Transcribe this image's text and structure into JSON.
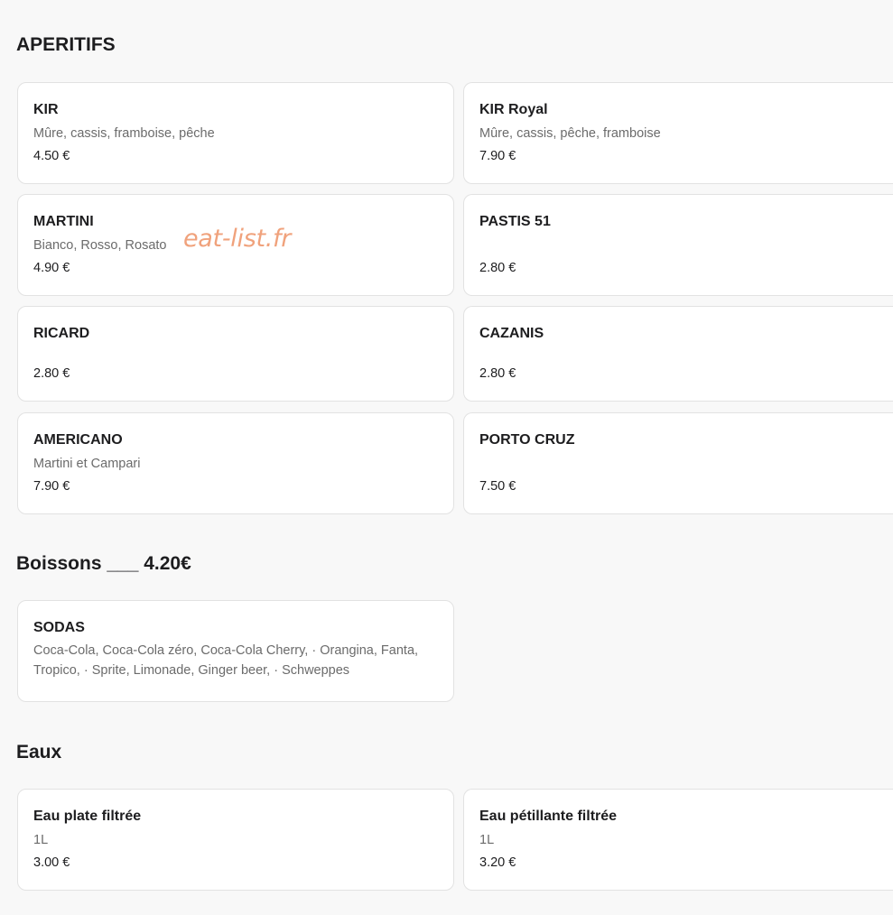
{
  "sections": {
    "aperitifs": {
      "title": "APERITIFS",
      "items": [
        {
          "name": "KIR",
          "description": "Mûre, cassis, framboise, pêche",
          "price": "4.50 €"
        },
        {
          "name": "KIR Royal",
          "description": "Mûre, cassis, pêche, framboise",
          "price": "7.90 €"
        },
        {
          "name": "MARTINI",
          "description": "Bianco, Rosso, Rosato",
          "price": "4.90 €"
        },
        {
          "name": "PASTIS 51",
          "description": "",
          "price": "2.80 €"
        },
        {
          "name": "RICARD",
          "description": "",
          "price": "2.80 €"
        },
        {
          "name": "CAZANIS",
          "description": "",
          "price": "2.80 €"
        },
        {
          "name": "AMERICANO",
          "description": "Martini et Campari",
          "price": "7.90 €"
        },
        {
          "name": "PORTO CRUZ",
          "description": "",
          "price": "7.50 €"
        }
      ]
    },
    "boissons": {
      "title": "Boissons ___ 4.20€",
      "items": [
        {
          "name": "SODAS",
          "description": "Coca-Cola, Coca-Cola zéro, Coca-Cola Cherry, · Orangina, Fanta, Tropico, · Sprite, Limonade, Ginger beer, · Schweppes"
        }
      ]
    },
    "eaux": {
      "title": "Eaux",
      "items": [
        {
          "name": "Eau plate filtrée",
          "description": "1L",
          "price": "3.00 €"
        },
        {
          "name": "Eau pétillante filtrée",
          "description": "1L",
          "price": "3.20 €"
        }
      ]
    }
  },
  "watermark": "eat-list.fr",
  "colors": {
    "background": "#f8f8f8",
    "card": "#ffffff",
    "border": "#e2e2e2",
    "watermark": "#f0a27c",
    "muted_text": "#6b6b6b"
  }
}
